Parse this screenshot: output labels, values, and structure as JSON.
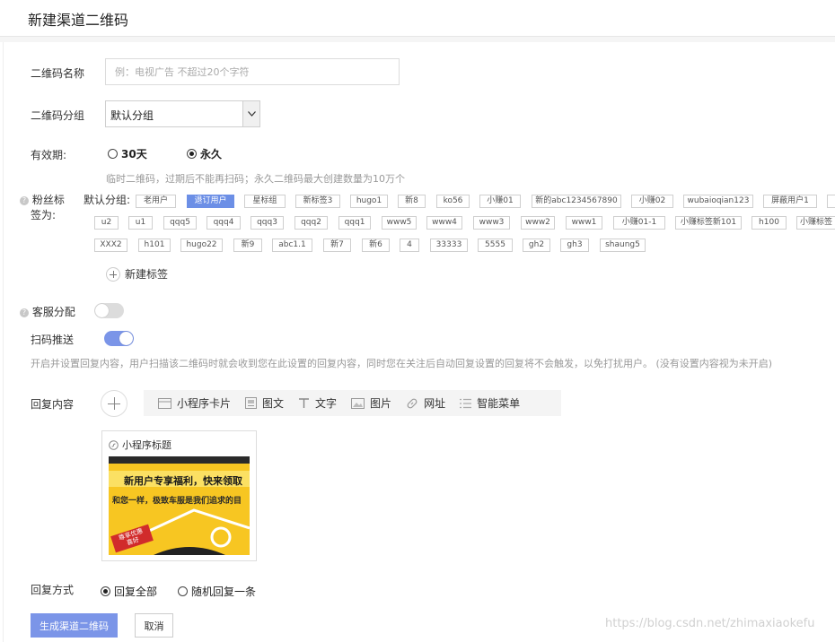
{
  "header": {
    "title": "新建渠道二维码"
  },
  "form": {
    "name_label": "二维码名称",
    "name_placeholder": "例：电视广告 不超过20个字符",
    "group_label": "二维码分组",
    "group_value": "默认分组",
    "validity_label": "有效期:",
    "validity_options": [
      "30天",
      "永久"
    ],
    "validity_selected": "永久",
    "validity_help": "临时二维码，过期后不能再扫码；永久二维码最大创建数量为10万个",
    "fans_label_1": "粉丝标",
    "fans_label_2": "签为:",
    "tag_group_label": "默认分组:",
    "tags_row1": [
      "老用户",
      "退订用户",
      "星标组",
      "新标签3",
      "hugo1",
      "新8",
      "ko56",
      "小赚01",
      "新的abc1234567890",
      "小赚02",
      "wubaioqian123",
      "屏蔽用户1"
    ],
    "tags_row2": [
      "u2",
      "u1",
      "qqq5",
      "qqq4",
      "qqq3",
      "qqq2",
      "qqq1",
      "www5",
      "www4",
      "www3",
      "www2",
      "www1",
      "小赚01-1",
      "小赚标签新101",
      "h100",
      "小赚标签"
    ],
    "tags_row3": [
      "XXX2",
      "h101",
      "hugo22",
      "新9",
      "abc1.1",
      "新7",
      "新6",
      "4",
      "33333",
      "5555",
      "gh2",
      "gh3",
      "shaung5"
    ],
    "selected_tag": "退订用户",
    "new_tag_label": "新建标签",
    "service_label": "客服分配",
    "service_on": false,
    "push_label": "扫码推送",
    "push_on": true,
    "push_help": "开启并设置回复内容，用户扫描该二维码时就会收到您在此设置的回复内容，同时您在关注后自动回复设置的回复将不会触发，以免打扰用户。 (没有设置内容视为未开启)",
    "reply_label": "回复内容",
    "reply_types": [
      {
        "label": "小程序卡片",
        "icon": "mini-program-card-icon"
      },
      {
        "label": "图文",
        "icon": "article-icon"
      },
      {
        "label": "文字",
        "icon": "text-icon"
      },
      {
        "label": "图片",
        "icon": "image-icon"
      },
      {
        "label": "网址",
        "icon": "link-icon"
      },
      {
        "label": "智能菜单",
        "icon": "menu-icon"
      }
    ],
    "card_title": "小程序标题",
    "card_banner": "新用户专享福利，快来领取",
    "card_subtext": "和您一样，极致车服是我们追求的目",
    "card_stamp_1": "尊享优惠",
    "card_stamp_2": "喜好",
    "reply_mode_label": "回复方式",
    "reply_mode_options": [
      "回复全部",
      "随机回复一条"
    ],
    "reply_mode_selected": "回复全部"
  },
  "actions": {
    "generate": "生成渠道二维码",
    "cancel": "取消"
  },
  "watermark": "https://blog.csdn.net/zhimaxiaokefu",
  "colors": {
    "primary": "#7b95e8",
    "selected_tag": "#6c8fe6"
  }
}
